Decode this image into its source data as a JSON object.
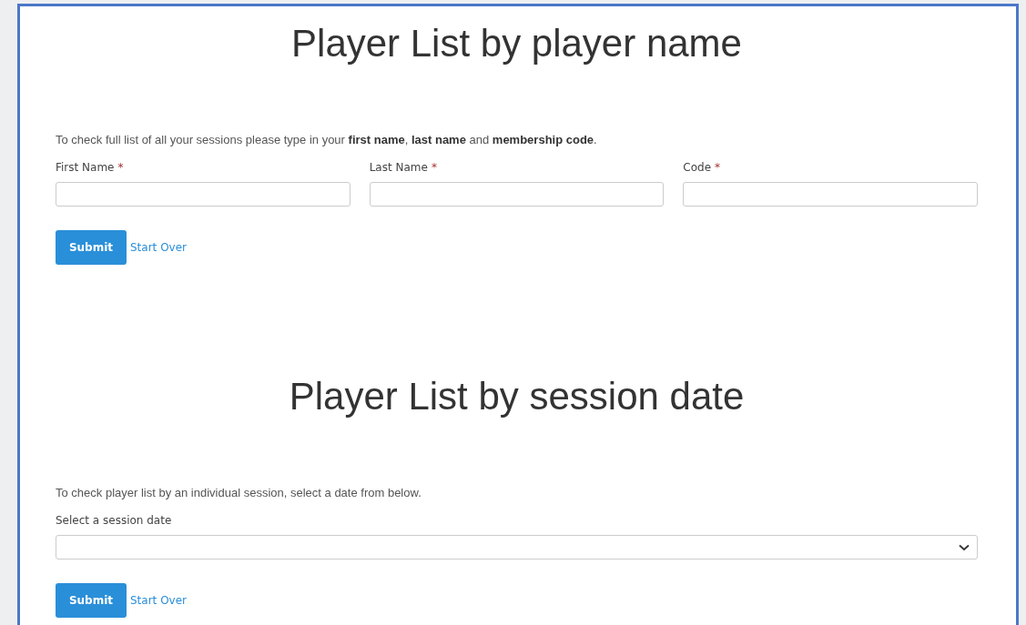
{
  "sections": [
    {
      "title": "Player List by player name",
      "intro": "To check full list of all your sessions please type in your **first name**, **last name** and **membership code**.",
      "fields": [
        {
          "kind": "text",
          "label": "First Name",
          "required_mark": "*"
        },
        {
          "kind": "text",
          "label": "Last Name",
          "required_mark": "*"
        },
        {
          "kind": "text",
          "label": "Code",
          "required_mark": "*"
        }
      ],
      "submit": "Submit",
      "reset": "Start Over"
    },
    {
      "title": "Player List by session date",
      "intro": "To check player list by an individual session, select a date from below.",
      "fields": [
        {
          "kind": "select",
          "label": "Select a session date"
        }
      ],
      "submit": "Submit",
      "reset": "Start Over"
    }
  ]
}
